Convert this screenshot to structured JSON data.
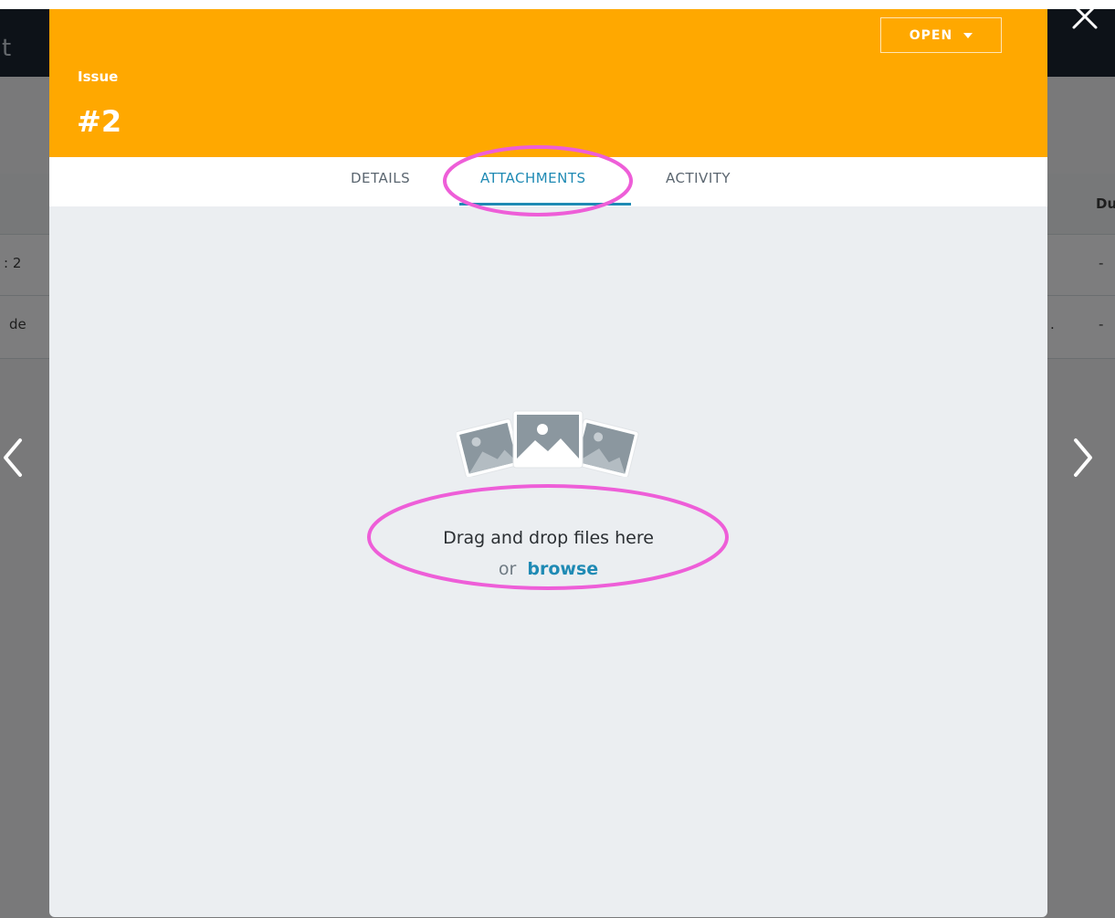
{
  "background_app": {
    "logo_fragment": "t",
    "table_header_fragment": "Du",
    "rows": [
      {
        "left_fragment": ": 2",
        "right_value": "-"
      },
      {
        "left_fragment": "de",
        "mid_fragment": ".",
        "right_value": "-"
      }
    ]
  },
  "modal": {
    "header": {
      "label": "Issue",
      "number": "#2",
      "status_button_label": "OPEN",
      "color": "#ffa800"
    },
    "tabs": [
      {
        "label": "DETAILS",
        "active": false
      },
      {
        "label": "ATTACHMENTS",
        "active": true
      },
      {
        "label": "ACTIVITY",
        "active": false
      }
    ],
    "attachments": {
      "drop_text": "Drag and drop files here",
      "or_text": "or",
      "browse_label": "browse"
    }
  },
  "icons": {
    "close": "close-icon",
    "prev": "chevron-left-icon",
    "next": "chevron-right-icon",
    "status_caret": "caret-down-icon",
    "images": "images-placeholder-icon"
  },
  "colors": {
    "accent": "#1f8ab4",
    "highlight_annotation": "#ee5ed8",
    "overlay": "#000000"
  }
}
